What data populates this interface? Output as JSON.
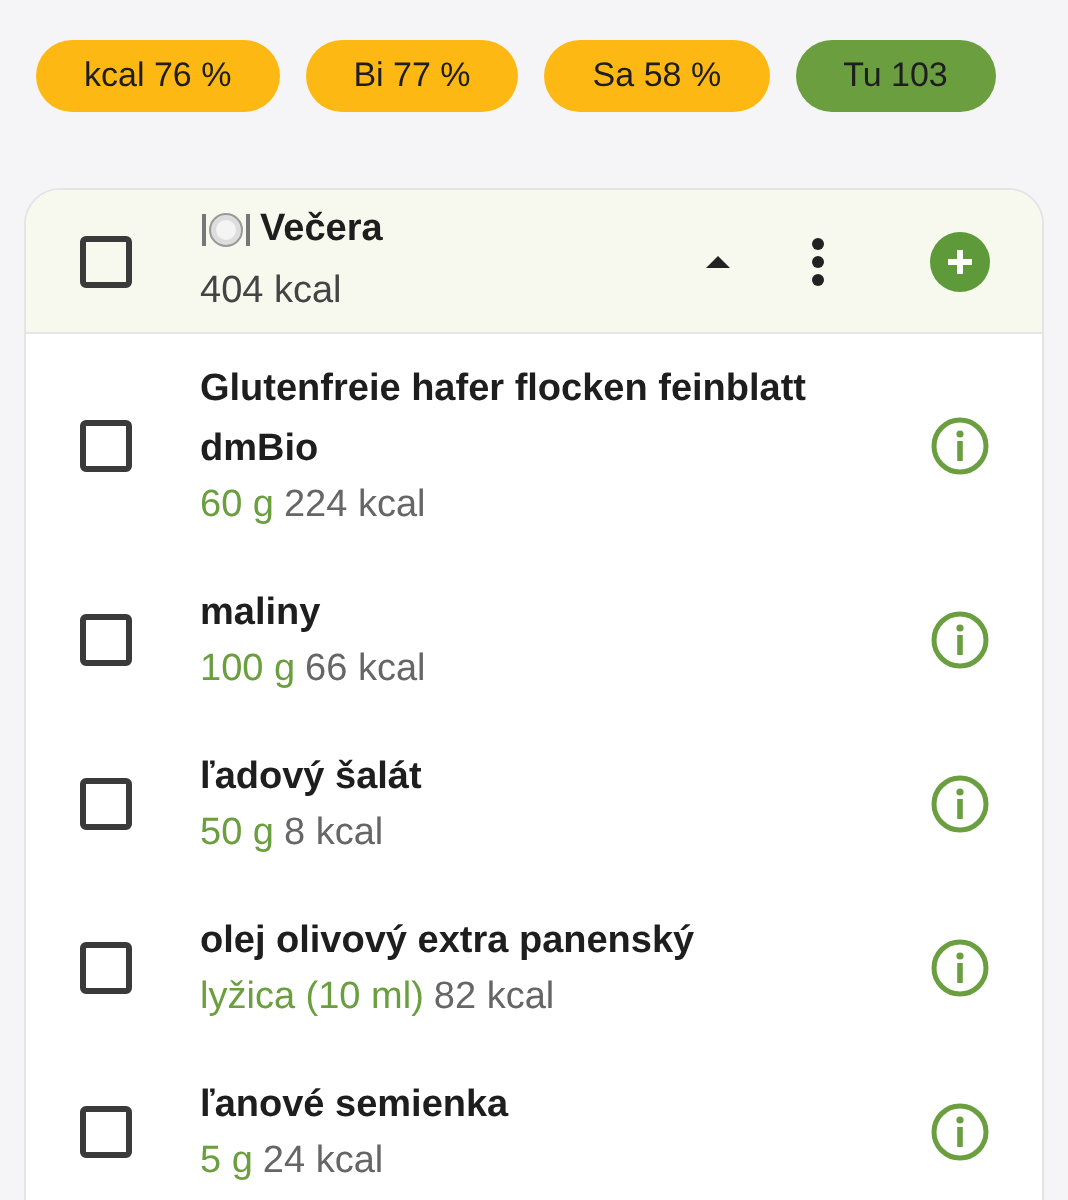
{
  "chips": [
    {
      "label": "kcal 76 %",
      "color": "#fdb813"
    },
    {
      "label": "Bi 77 %",
      "color": "#fdb813"
    },
    {
      "label": "Sa 58 %",
      "color": "#fdb813"
    },
    {
      "label": "Tu 103",
      "color": "#6a9e3f"
    }
  ],
  "meal": {
    "title": "Večera",
    "energy": "404 kcal",
    "checked": false,
    "expanded": true,
    "items": [
      {
        "name": "Glutenfreie hafer flocken feinblatt dmBio",
        "amount": "60 g",
        "energy": "224 kcal",
        "checked": false
      },
      {
        "name": "maliny",
        "amount": "100 g",
        "energy": "66 kcal",
        "checked": false
      },
      {
        "name": "ľadový šalát",
        "amount": "50 g",
        "energy": "8 kcal",
        "checked": false
      },
      {
        "name": "olej olivový extra panenský",
        "amount": "lyžica (10 ml)",
        "energy": "82 kcal",
        "checked": false
      },
      {
        "name": "ľanové semienka",
        "amount": "5 g",
        "energy": "24 kcal",
        "checked": false
      }
    ]
  }
}
